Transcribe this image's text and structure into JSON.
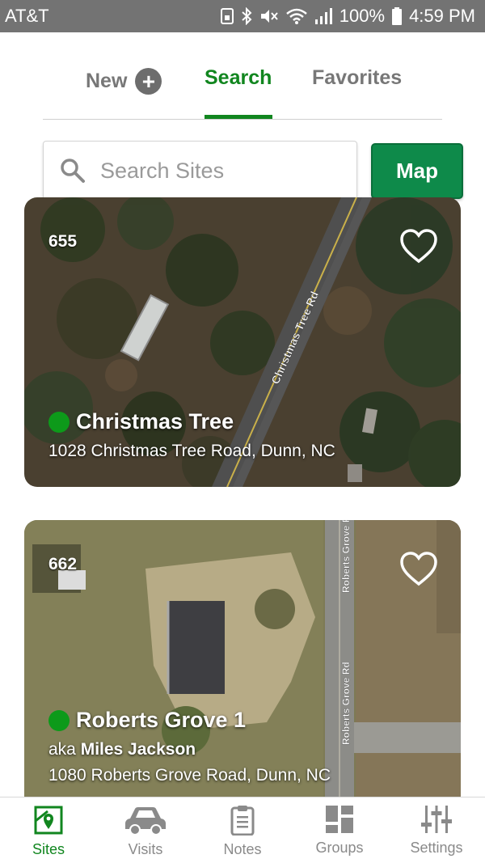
{
  "status_bar": {
    "carrier": "AT&T",
    "battery": "100%",
    "time": "4:59 PM"
  },
  "tabs": {
    "new_label": "New",
    "search_label": "Search",
    "favorites_label": "Favorites",
    "active": "Search"
  },
  "search": {
    "placeholder": "Search Sites",
    "value": ""
  },
  "map_button_label": "Map",
  "sites": [
    {
      "number": "655",
      "name": "Christmas Tree",
      "address": "1028 Christmas Tree Road, Dunn, NC",
      "road_label": "Christmas Tree Rd",
      "status_color": "#0d9a1a"
    },
    {
      "number": "662",
      "name": "Roberts Grove 1",
      "aka_prefix": "aka",
      "aka_name": "Miles Jackson",
      "address": "1080 Roberts Grove Road, Dunn, NC",
      "road_label": "Roberts Grove Rd",
      "status_color": "#0d9a1a"
    }
  ],
  "bottom_nav": {
    "items": [
      {
        "label": "Sites",
        "icon": "map-pin-icon"
      },
      {
        "label": "Visits",
        "icon": "car-icon"
      },
      {
        "label": "Notes",
        "icon": "clipboard-icon"
      },
      {
        "label": "Groups",
        "icon": "grid-icon"
      },
      {
        "label": "Settings",
        "icon": "sliders-icon"
      }
    ],
    "active": "Sites"
  },
  "colors": {
    "accent_green": "#11861f",
    "map_button": "#0e8a4a",
    "status_bar": "#737373"
  }
}
